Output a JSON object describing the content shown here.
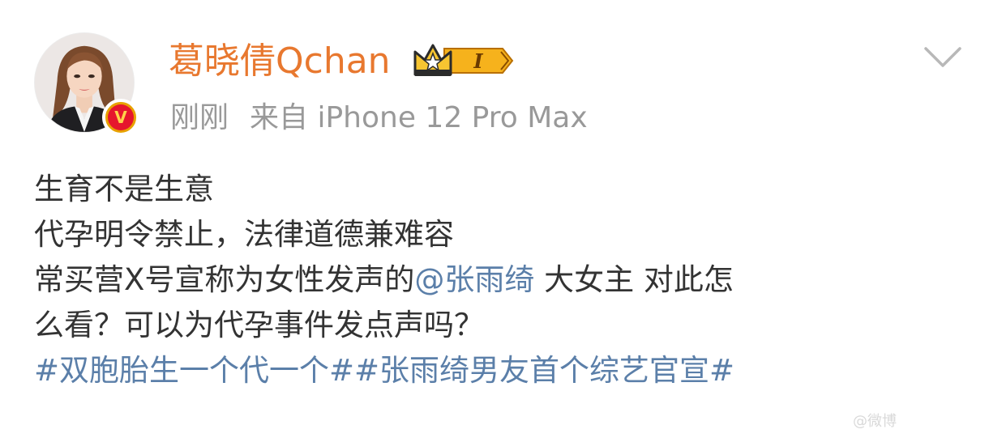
{
  "author": {
    "name": "葛晓倩Qchan",
    "vip_level": "I",
    "verified_mark": "V",
    "avatar_icon": "avatar-photo"
  },
  "meta": {
    "time": "刚刚",
    "source": "来自 iPhone 12 Pro Max"
  },
  "post": {
    "line1": "生育不是生意",
    "line2": "代孕明令禁止，法律道德兼难容",
    "line3_prefix": "常买营X号宣称为女性发声的",
    "mention": "@张雨绮",
    "line3_suffix": " 大女主 对此怎",
    "line4": "么看？可以为代孕事件发点声吗？",
    "hashtag1": "#双胞胎生一个代一个#",
    "hashtag2": "#张雨绮男友首个综艺官宣#"
  },
  "watermark": "@微博",
  "colors": {
    "username": "#e8782f",
    "link": "#5b7fa9",
    "text": "#333333",
    "meta": "#999999",
    "verified": "#e6162d"
  }
}
